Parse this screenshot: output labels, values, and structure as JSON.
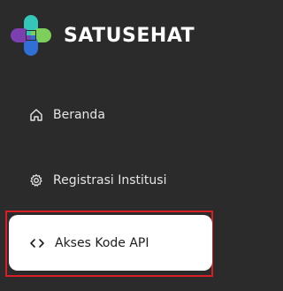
{
  "brand": {
    "name": "SATUSEHAT",
    "logo_icon": "satusehat-cross-logo",
    "logo_colors": [
      "#34c7b9",
      "#7ccf5a",
      "#2f6fd6",
      "#7b3fb0"
    ]
  },
  "nav": {
    "items": [
      {
        "label": "Beranda",
        "icon": "home-icon",
        "active": false
      },
      {
        "label": "Registrasi Institusi",
        "icon": "gear-icon",
        "active": false
      },
      {
        "label": "Akses Kode API",
        "icon": "code-icon",
        "active": true
      }
    ]
  },
  "colors": {
    "background": "#2b2b2b",
    "nav_text": "#e6e6e6",
    "active_card": "#ffffff",
    "highlight_border": "#d81f26"
  }
}
